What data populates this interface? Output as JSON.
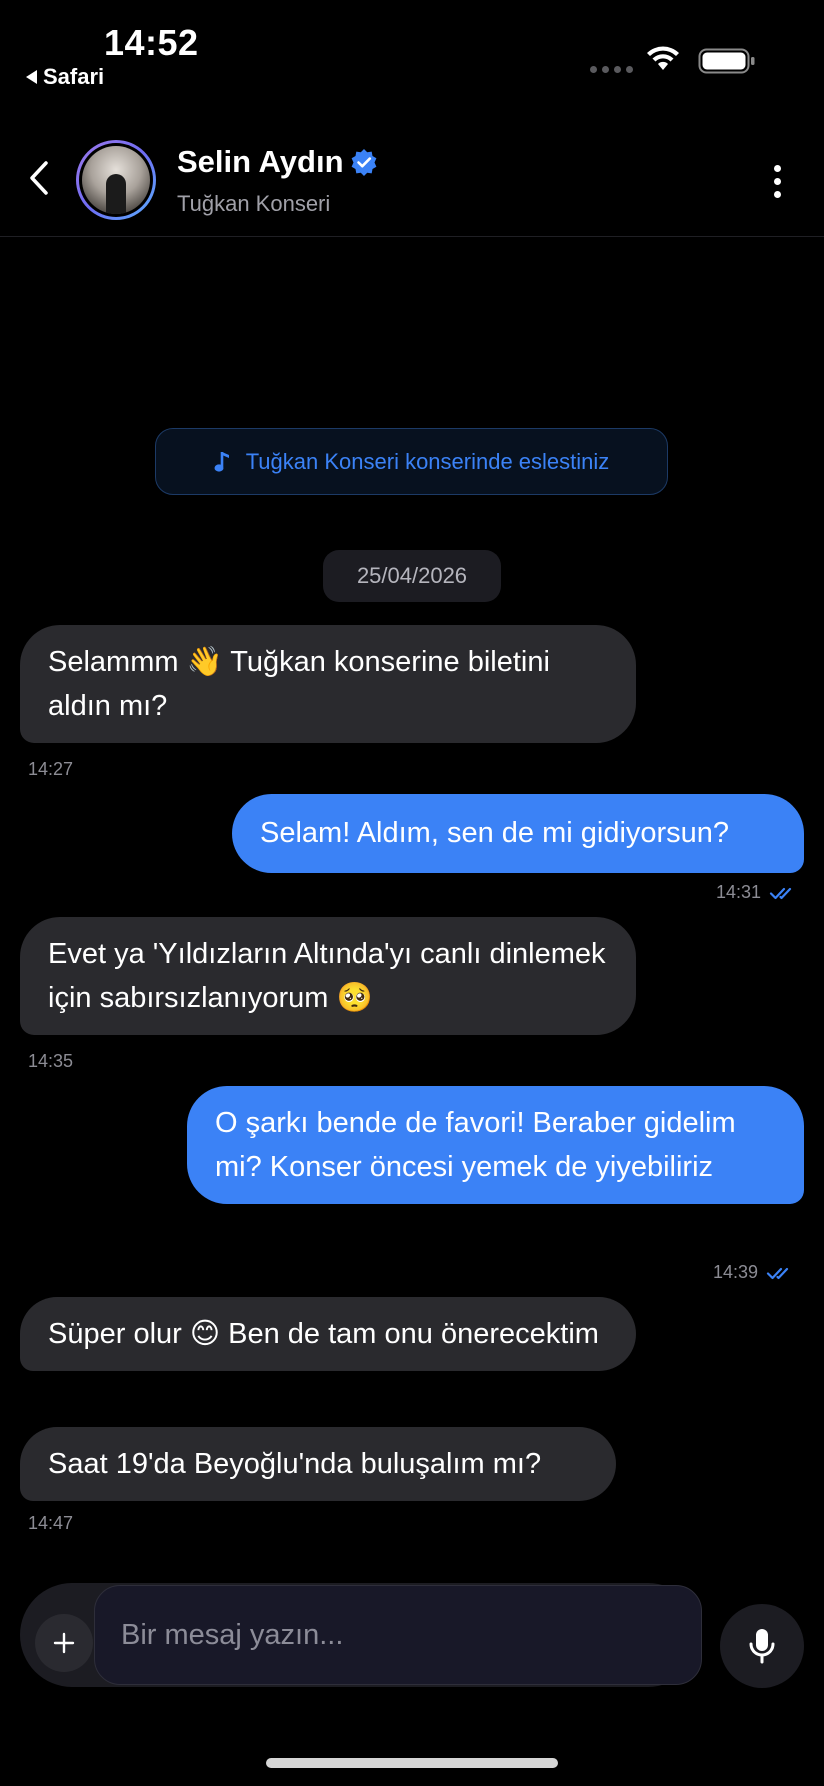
{
  "status_bar": {
    "time": "14:52",
    "back_app": "Safari"
  },
  "header": {
    "contact_name": "Selin Aydın",
    "subtitle": "Tuğkan Konseri"
  },
  "match_banner": {
    "text": "Tuğkan Konseri konserinde eslestiniz",
    "icon": "music-note-icon"
  },
  "date_separator": "25/04/2026",
  "messages": [
    {
      "from": "them",
      "text": "Selammm 👋 Tuğkan konserine biletini aldın mı?",
      "time": "14:27"
    },
    {
      "from": "me",
      "text": "Selam! Aldım, sen de mi gidiyorsun?",
      "time": "14:31",
      "read": true
    },
    {
      "from": "them",
      "text": "Evet ya 'Yıldızların Altında'yı canlı dinlemek için sabırsızlanıyorum 🥺",
      "time": "14:35"
    },
    {
      "from": "me",
      "text": "O şarkı bende de favori! Beraber gidelim mi? Konser öncesi yemek de yiyebiliriz",
      "time": "14:39",
      "read": true
    },
    {
      "from": "them",
      "text": "Süper olur 😊 Ben de tam onu önerecektim",
      "time": ""
    },
    {
      "from": "them",
      "text": "Saat 19'da Beyoğlu'nda buluşalım mı?",
      "time": "14:47"
    }
  ],
  "composer": {
    "placeholder": "Bir mesaj yazın..."
  },
  "colors": {
    "accent": "#3b82f6",
    "incoming_bubble": "#2a2a2e",
    "background": "#000000"
  }
}
